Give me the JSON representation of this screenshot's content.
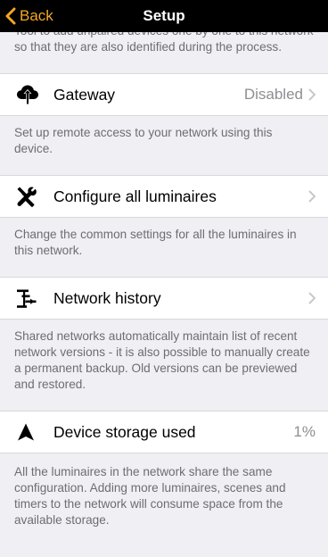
{
  "nav": {
    "back_label": "Back",
    "title": "Setup"
  },
  "sections": {
    "intro": {
      "description": "Tool to add unpaired devices one by one to this network so that they are also identified during the process."
    },
    "gateway": {
      "label": "Gateway",
      "value": "Disabled",
      "icon": "cloud-upload-icon",
      "description": "Set up remote access to your network using this device."
    },
    "configure": {
      "label": "Configure all luminaires",
      "icon": "tools-icon",
      "description": "Change the common settings for all the luminaires in this network."
    },
    "history": {
      "label": "Network history",
      "icon": "history-icon",
      "description": "Shared networks automatically maintain list of recent network versions - it is also possible to manually create a permanent backup. Old versions can be previewed and restored."
    },
    "storage": {
      "label": "Device storage used",
      "value": "1%",
      "icon": "storage-triangle-icon",
      "description": "All the luminaires in the network share the same configuration. Adding more luminaires, scenes and timers to the network will consume space from the available storage."
    }
  },
  "colors": {
    "accent": "#f5a623",
    "background": "#efeff4",
    "secondary_text": "#6d6d72"
  }
}
